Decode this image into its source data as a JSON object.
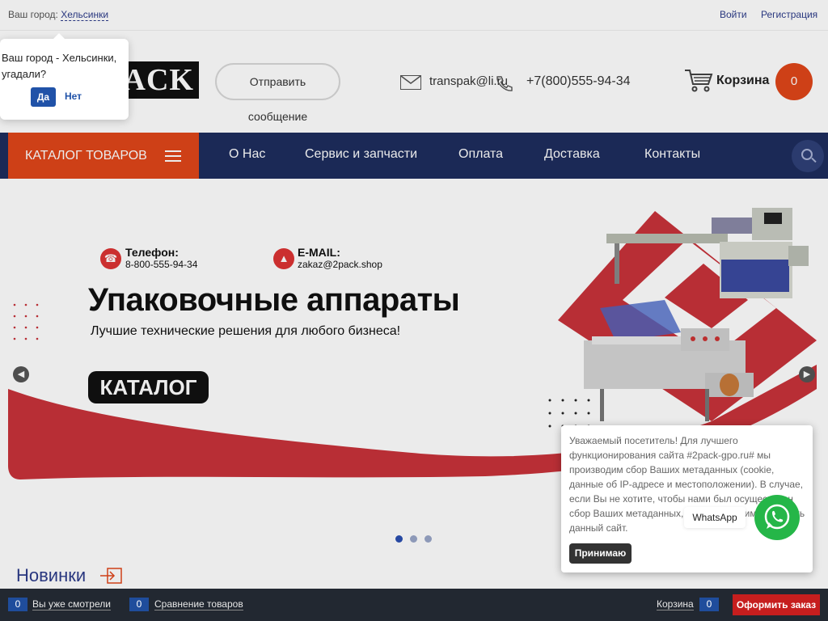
{
  "topbar": {
    "city_prefix": "Ваш город:",
    "city_name": "Хельсинки",
    "login": "Войти",
    "register": "Регистрация"
  },
  "header": {
    "logo_text": "PACK",
    "send_label_line1": "Отправить",
    "send_label_line2": "сообщение",
    "email": "transpak@li.ru",
    "phone": "+7(800)555-94-34",
    "cart_label": "Корзина",
    "cart_count": "0"
  },
  "nav": {
    "catalog": "КАТАЛОГ ТОВАРОВ",
    "items": [
      {
        "label": "О Нас"
      },
      {
        "label": "Сервис и запчасти"
      },
      {
        "label": "Оплата"
      },
      {
        "label": "Доставка"
      },
      {
        "label": "Контакты"
      }
    ]
  },
  "banner": {
    "phone_title": "Телефон:",
    "phone_value": "8-800-555-94-34",
    "email_title": "E-MAIL:",
    "email_value": "zakaz@2pack.shop",
    "title": "Упаковочные аппараты",
    "subtitle": "Лучшие технические решения для любого бизнеса!",
    "button": "КАТАЛОГ",
    "slides_total": 3,
    "active_slide": 1
  },
  "section": {
    "new_heading": "Новинки"
  },
  "city_popup": {
    "question": "Ваш город - Хельсинки, угадали?",
    "yes": "Да",
    "no": "Нет"
  },
  "cookie": {
    "text": "Уважаемый посетитель! Для лучшего функционирования сайта #2pack-gpo.ru# мы производим сбор Ваших метаданных (cookie, данные об IP-адресе и местоположении). В случае, если Вы не хотите, чтобы нами был осуществлен сбор Ваших метаданных, Вам необходимо покинуть данный сайт.",
    "accept": "Принимаю"
  },
  "whatsapp": {
    "label": "WhatsApp"
  },
  "bottombar": {
    "viewed_count": "0",
    "viewed_label": "Вы уже смотрели",
    "compare_count": "0",
    "compare_label": "Сравнение товаров",
    "cart_label": "Корзина",
    "cart_count": "0",
    "order": "Оформить заказ"
  },
  "colors": {
    "accent_orange": "#e0461a",
    "nav_blue": "#1e2d5e",
    "banner_red": "#c8323a",
    "whatsapp_green": "#25b648",
    "order_red": "#c61e1e"
  }
}
